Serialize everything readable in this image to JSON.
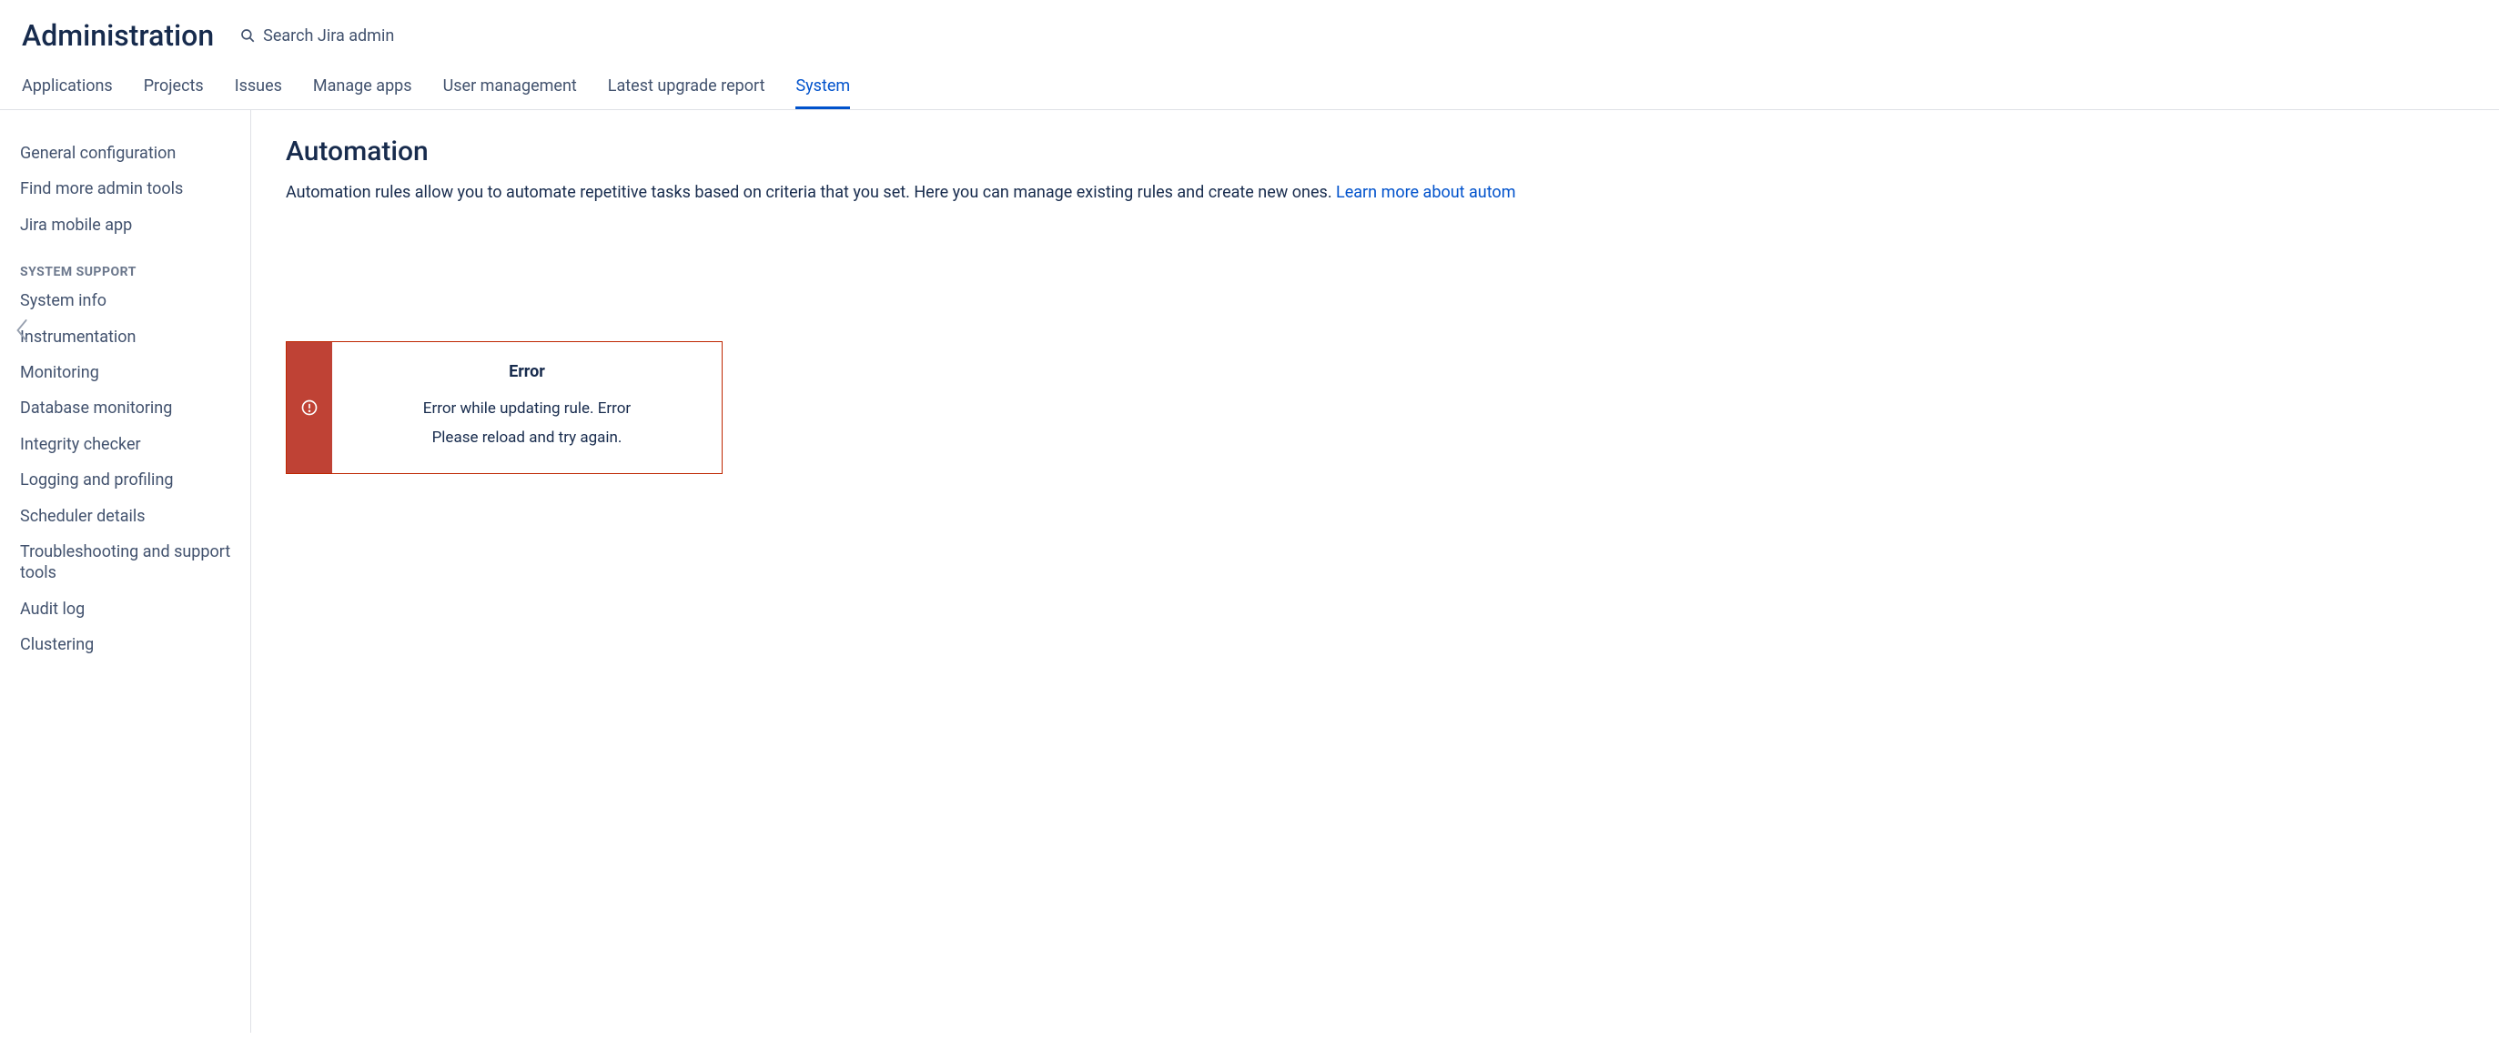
{
  "header": {
    "title": "Administration",
    "search_placeholder": "Search Jira admin"
  },
  "tabs": [
    {
      "label": "Applications",
      "active": false
    },
    {
      "label": "Projects",
      "active": false
    },
    {
      "label": "Issues",
      "active": false
    },
    {
      "label": "Manage apps",
      "active": false
    },
    {
      "label": "User management",
      "active": false
    },
    {
      "label": "Latest upgrade report",
      "active": false
    },
    {
      "label": "System",
      "active": true
    }
  ],
  "sidebar": {
    "top_items": [
      "General configuration",
      "Find more admin tools",
      "Jira mobile app"
    ],
    "section_header": "SYSTEM SUPPORT",
    "support_items": [
      "System info",
      "Instrumentation",
      "Monitoring",
      "Database monitoring",
      "Integrity checker",
      "Logging and profiling",
      "Scheduler details",
      "Troubleshooting and support tools",
      "Audit log",
      "Clustering"
    ]
  },
  "main": {
    "title": "Automation",
    "description": "Automation rules allow you to automate repetitive tasks based on criteria that you set. Here you can manage existing rules and create new ones. ",
    "learn_more": "Learn more about autom"
  },
  "error": {
    "title": "Error",
    "line1": "Error while updating rule. Error",
    "line2": "Please reload and try again."
  }
}
